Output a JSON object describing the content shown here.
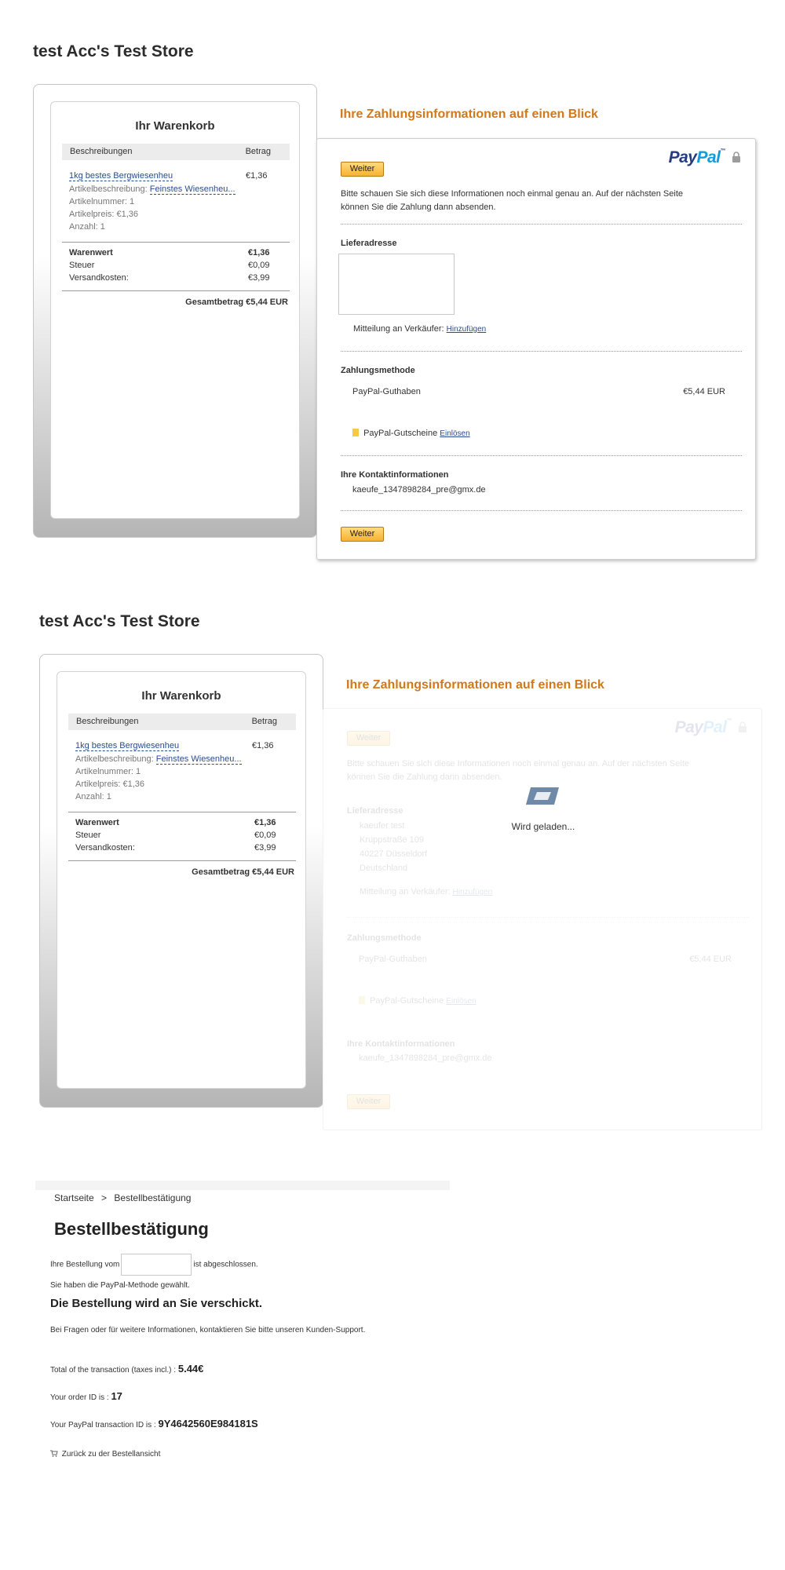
{
  "screen1": {
    "store_title": "test Acc's Test Store",
    "cart": {
      "title": "Ihr Warenkorb",
      "col_desc": "Beschreibungen",
      "col_amount": "Betrag",
      "item_name": "1kg bestes Bergwiesenheu",
      "item_price": "€1,36",
      "item_desc_label": "Artikelbeschreibung:",
      "item_desc_value": "Feinstes Wiesenheu...",
      "item_number": "Artikelnummer: 1",
      "item_unit_price": "Artikelpreis: €1,36",
      "item_qty": "Anzahl: 1",
      "subtotal_label": "Warenwert",
      "subtotal_value": "€1,36",
      "tax_label": "Steuer",
      "tax_value": "€0,09",
      "shipping_label": "Versandkosten:",
      "shipping_value": "€3,99",
      "grand_total": "Gesamtbetrag €5,44 EUR"
    },
    "payment": {
      "heading": "Ihre Zahlungsinformationen auf einen Blick",
      "logo_pay": "Pay",
      "logo_pal": "Pal",
      "logo_tm": "™",
      "continue_top": "Weiter",
      "intro_text": "Bitte schauen Sie sich diese Informationen noch einmal genau an. Auf der nächsten Seite können Sie die Zahlung dann absenden.",
      "shipping_title": "Lieferadresse",
      "seller_msg_label": "Mitteilung an Verkäufer:",
      "seller_msg_link": "Hinzufügen",
      "method_title": "Zahlungsmethode",
      "balance_label": "PayPal-Guthaben",
      "balance_amount": "€5,44 EUR",
      "coupon_label": "PayPal-Gutscheine",
      "coupon_link": "Einlösen",
      "contact_title": "Ihre Kontaktinformationen",
      "contact_email": "kaeufe_1347898284_pre@gmx.de",
      "continue_bottom": "Weiter"
    }
  },
  "screen2": {
    "store_title": "test Acc's Test Store",
    "cart": {
      "title": "Ihr Warenkorb",
      "col_desc": "Beschreibungen",
      "col_amount": "Betrag",
      "item_name": "1kg bestes Bergwiesenheu",
      "item_price": "€1,36",
      "item_desc_label": "Artikelbeschreibung:",
      "item_desc_value": "Feinstes Wiesenheu...",
      "item_number": "Artikelnummer: 1",
      "item_unit_price": "Artikelpreis: €1,36",
      "item_qty": "Anzahl: 1",
      "subtotal_label": "Warenwert",
      "subtotal_value": "€1,36",
      "tax_label": "Steuer",
      "tax_value": "€0,09",
      "shipping_label": "Versandkosten:",
      "shipping_value": "€3,99",
      "grand_total": "Gesamtbetrag €5,44 EUR"
    },
    "payment": {
      "heading": "Ihre Zahlungsinformationen auf einen Blick",
      "logo_pay": "Pay",
      "logo_pal": "Pal",
      "logo_tm": "™",
      "continue_top": "Weiter",
      "intro_text": "Bitte schauen Sie sich diese Informationen noch einmal genau an. Auf der nächsten Seite können Sie die Zahlung dann absenden.",
      "shipping_title": "Lieferadresse",
      "address_line1": "kaeufer test",
      "address_line2": "Kruppstraße 109",
      "address_line3": "40227 Düsseldorf",
      "address_line4": "Deutschland",
      "seller_msg_label": "Mitteilung an Verkäufer:",
      "seller_msg_link": "Hinzufügen",
      "method_title": "Zahlungsmethode",
      "balance_label": "PayPal-Guthaben",
      "balance_amount": "€5,44 EUR",
      "coupon_label": "PayPal-Gutscheine",
      "coupon_link": "Einlösen",
      "contact_title": "Ihre Kontaktinformationen",
      "contact_email": "kaeufe_1347898284_pre@gmx.de",
      "continue_bottom": "Weiter",
      "loading_text": "Wird geladen..."
    }
  },
  "confirmation": {
    "breadcrumb_home": "Startseite",
    "breadcrumb_sep": ">",
    "breadcrumb_current": "Bestellbestätigung",
    "title": "Bestellbestätigung",
    "order_prefix": "Ihre Bestellung vom",
    "order_suffix": "ist abgeschlossen.",
    "method_text": "Sie haben die PayPal-Methode gewählt.",
    "shipping_heading": "Die Bestellung wird an Sie verschickt.",
    "support_text": "Bei Fragen oder für weitere Informationen, kontaktieren Sie bitte unseren Kunden-Support.",
    "total_label": "Total of the transaction (taxes incl.) :",
    "total_value": "5.44€",
    "order_id_label": "Your order ID is :",
    "order_id_value": "17",
    "txn_label": "Your PayPal transaction ID is :",
    "txn_value": "9Y4642560E984181S",
    "back_link": "Zurück zu der Bestellansicht"
  },
  "colors": {
    "accent_orange": "#d0791c",
    "button_gold": "#f7b233",
    "link_blue": "#2a4d8f",
    "paypal_dark": "#253b80",
    "paypal_light": "#179bd7"
  },
  "icons": {
    "lock": "lock-icon",
    "coupon": "coupon-icon",
    "loader": "loader-icon",
    "cart": "cart-icon"
  }
}
